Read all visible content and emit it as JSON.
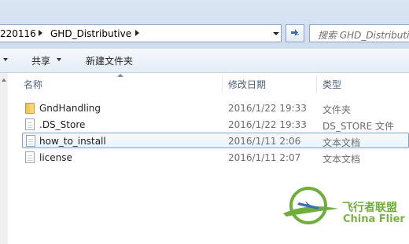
{
  "address": {
    "crumbs": [
      "220116",
      "GHD_Distributive"
    ],
    "search_placeholder": "搜索 GHD_Distributive"
  },
  "toolbar": {
    "share_label": "共享",
    "new_folder_label": "新建文件夹"
  },
  "columns": {
    "name": "名称",
    "modified": "修改日期",
    "type": "类型"
  },
  "files": [
    {
      "name": "GndHandling",
      "modified": "2016/1/22 19:33",
      "type": "文件夹",
      "icon": "folder-icon"
    },
    {
      "name": ".DS_Store",
      "modified": "2016/1/22 19:33",
      "type": "DS_STORE 文件",
      "icon": "file-icon"
    },
    {
      "name": "how_to_install",
      "modified": "2016/1/11 2:06",
      "type": "文本文档",
      "icon": "file-icon"
    },
    {
      "name": "license",
      "modified": "2016/1/11 2:07",
      "type": "文本文档",
      "icon": "file-icon"
    }
  ],
  "watermark": {
    "cn": "飞行者联盟",
    "en": "China Flier",
    "colors": {
      "green": "#6fae3a",
      "blue": "#3b6fb0"
    }
  }
}
